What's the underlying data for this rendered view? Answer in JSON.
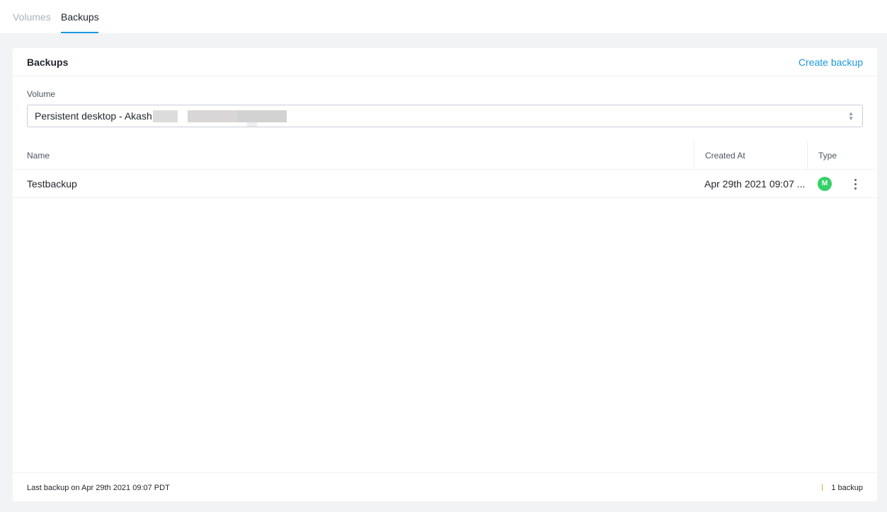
{
  "tabs": [
    {
      "label": "Volumes",
      "active": false
    },
    {
      "label": "Backups",
      "active": true
    }
  ],
  "panel": {
    "title": "Backups",
    "create_label": "Create backup"
  },
  "volume": {
    "label": "Volume",
    "selected": "Persistent desktop - Akash"
  },
  "table": {
    "columns": [
      "Name",
      "Created At",
      "Type"
    ],
    "rows": [
      {
        "name": "Testbackup",
        "created_at": "Apr 29th 2021 09:07 ...",
        "type_badge": "M"
      }
    ]
  },
  "footer": {
    "last_backup": "Last backup on Apr 29th 2021 09:07 PDT",
    "count": "1 backup"
  },
  "colors": {
    "accent": "#1b98e0",
    "badge": "#36d068"
  }
}
